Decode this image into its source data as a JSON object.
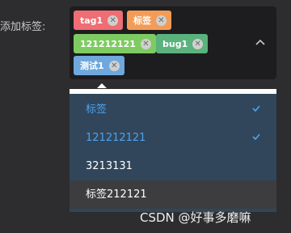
{
  "form": {
    "label": "添加标签:"
  },
  "tags": [
    {
      "text": "tag1",
      "color": "#ee6e73"
    },
    {
      "text": "标签",
      "color": "#f39c58"
    },
    {
      "text": "121212121",
      "color": "#7ecb62"
    },
    {
      "text": "bug1",
      "color": "#5ab27c"
    },
    {
      "text": "测试1",
      "color": "#6ea8dd"
    }
  ],
  "dropdown": {
    "options": [
      {
        "label": "标签",
        "selected": true
      },
      {
        "label": "121212121",
        "selected": true
      },
      {
        "label": "3213131",
        "selected": false
      },
      {
        "label": "标签212121",
        "selected": false,
        "hovered": true
      }
    ]
  },
  "colors": {
    "selected_text": "#4aa3f3",
    "dropdown_bg": "#31465a",
    "hover_bg": "#3d3d3f"
  },
  "watermark": "CSDN @好事多磨嘛"
}
